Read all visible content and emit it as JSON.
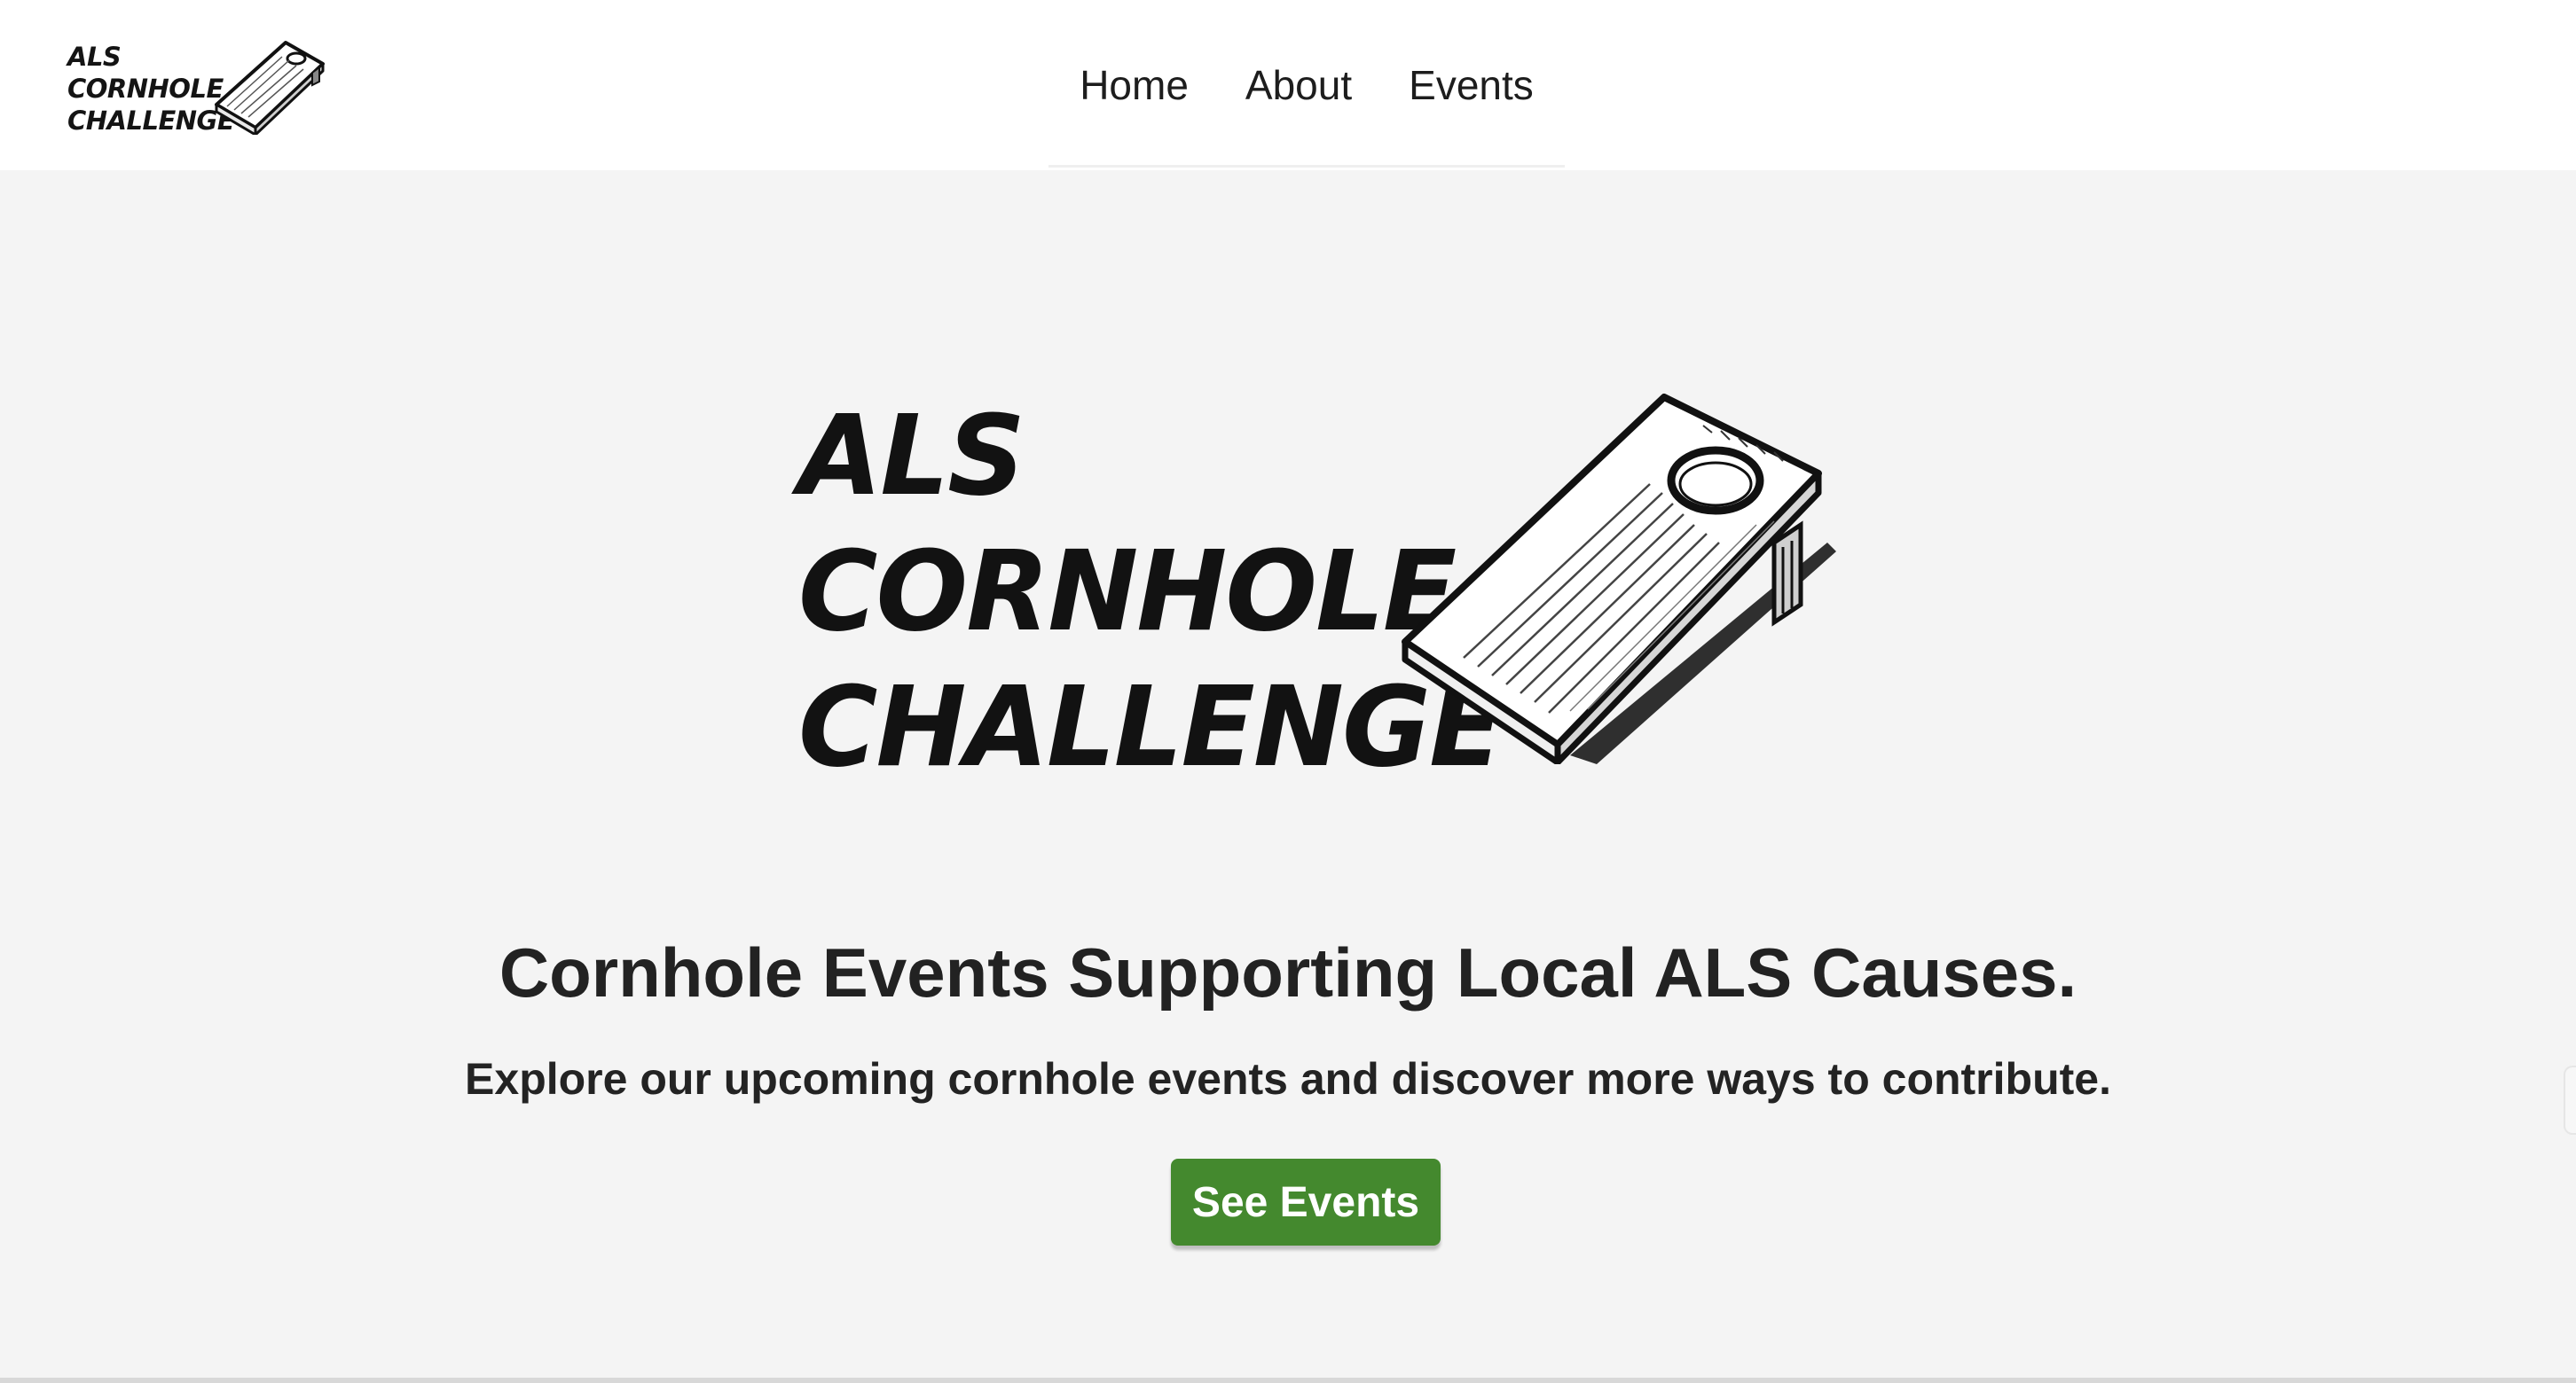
{
  "brand": {
    "logo_lines": [
      "ALS",
      "CORNHOLE",
      "CHALLENGE"
    ],
    "logo_icon": "cornhole-board-icon"
  },
  "nav": {
    "items": [
      {
        "label": "Home"
      },
      {
        "label": "About"
      },
      {
        "label": "Events"
      }
    ]
  },
  "hero": {
    "logo_lines": [
      "ALS",
      "CORNHOLE",
      "CHALLENGE"
    ],
    "logo_icon": "cornhole-board-icon",
    "heading": "Cornhole Events Supporting Local ALS Causes.",
    "subheading": "Explore our upcoming cornhole events and discover more ways to contribute.",
    "cta_label": "See Events"
  },
  "colors": {
    "page_background": "#f4f4f4",
    "header_background": "#ffffff",
    "cta_background": "#44892e",
    "cta_text": "#ffffff"
  }
}
